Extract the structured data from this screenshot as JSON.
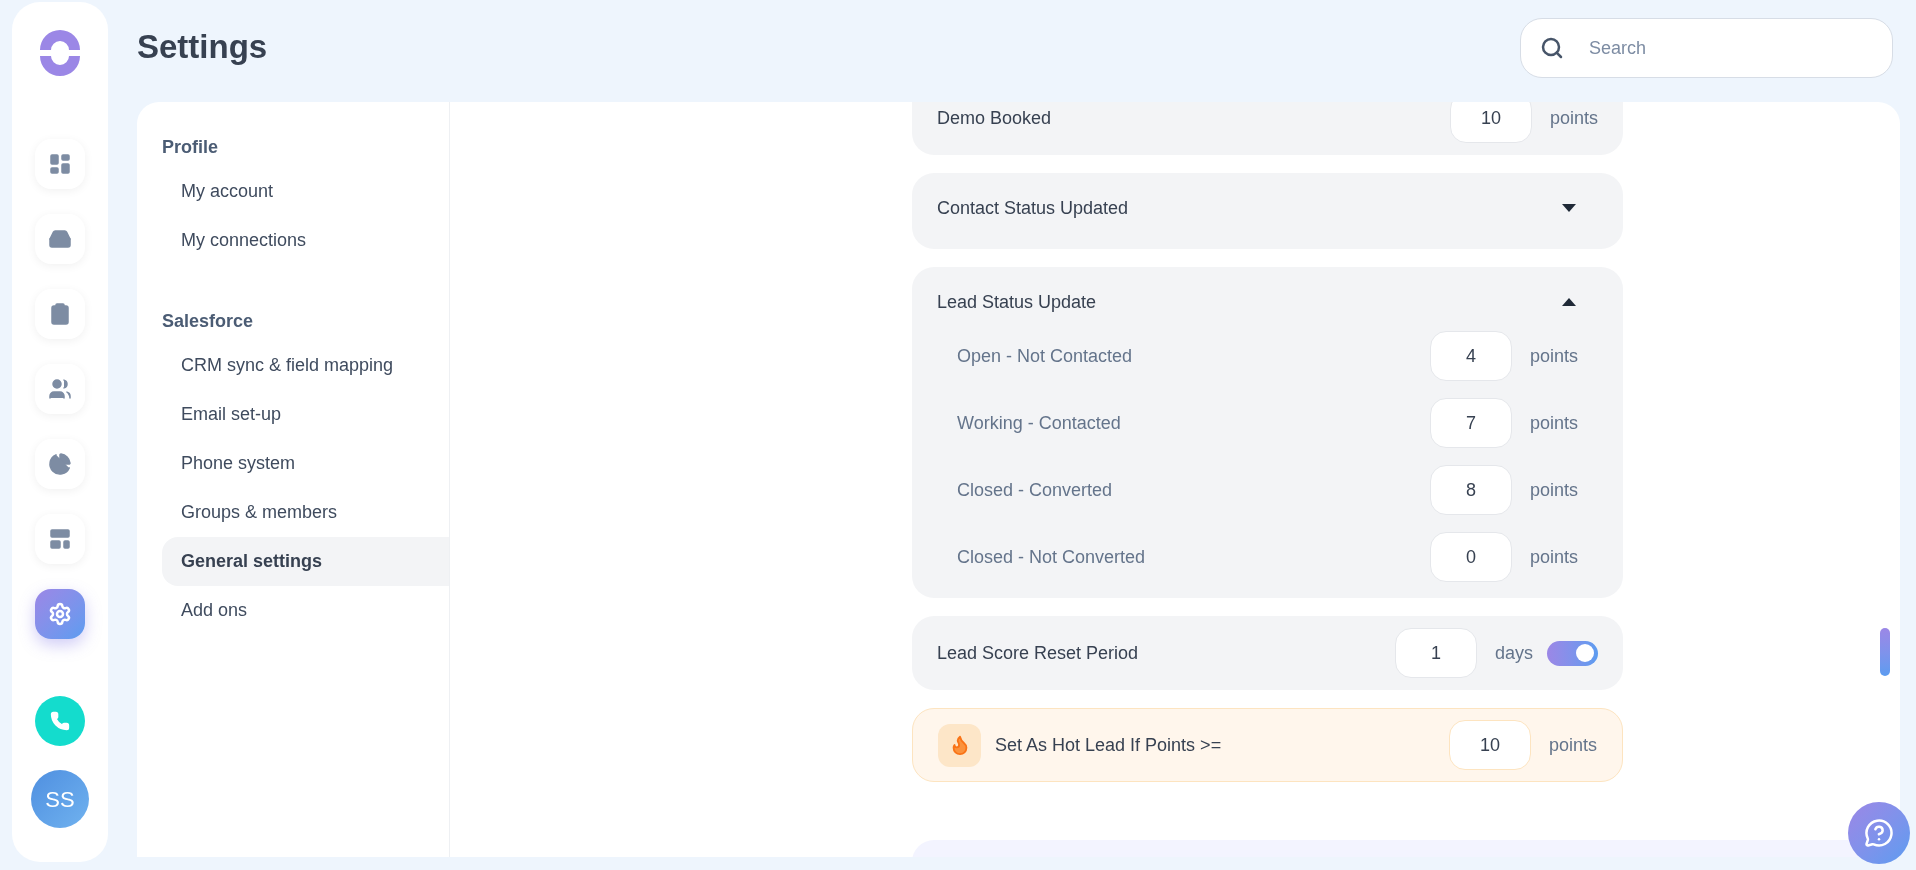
{
  "page_title": "Settings",
  "search": {
    "placeholder": "Search"
  },
  "rail_items": [
    {
      "selected": false
    },
    {
      "selected": false
    },
    {
      "selected": false
    },
    {
      "selected": false
    },
    {
      "selected": false
    },
    {
      "selected": false
    },
    {
      "selected": true
    }
  ],
  "avatar": {
    "initials": "SS"
  },
  "sidebar": {
    "sections": [
      {
        "title": "Profile",
        "items": [
          {
            "label": "My account",
            "selected": false
          },
          {
            "label": "My connections",
            "selected": false
          }
        ]
      },
      {
        "title": "Salesforce",
        "items": [
          {
            "label": "CRM sync & field mapping",
            "selected": false
          },
          {
            "label": "Email set-up",
            "selected": false
          },
          {
            "label": "Phone system",
            "selected": false
          },
          {
            "label": "Groups & members",
            "selected": false
          },
          {
            "label": "General settings",
            "selected": true
          },
          {
            "label": "Add ons",
            "selected": false
          }
        ]
      }
    ]
  },
  "cards": [
    {
      "kind": "points",
      "label": "Demo Booked",
      "value": "10",
      "unit": "points"
    },
    {
      "kind": "collapsible",
      "label": "Contact Status Updated",
      "expanded": false
    },
    {
      "kind": "collapsible",
      "label": "Lead Status Update",
      "expanded": true,
      "children": [
        {
          "label": "Open - Not Contacted",
          "value": "4",
          "unit": "points"
        },
        {
          "label": "Working - Contacted",
          "value": "7",
          "unit": "points"
        },
        {
          "label": "Closed - Converted",
          "value": "8",
          "unit": "points"
        },
        {
          "label": "Closed - Not Converted",
          "value": "0",
          "unit": "points"
        }
      ]
    },
    {
      "kind": "toggle",
      "label": "Lead Score Reset Period",
      "value": "1",
      "unit": "days",
      "on": true
    },
    {
      "kind": "hot",
      "label": "Set As Hot Lead If Points >=",
      "value": "10",
      "unit": "points"
    }
  ]
}
